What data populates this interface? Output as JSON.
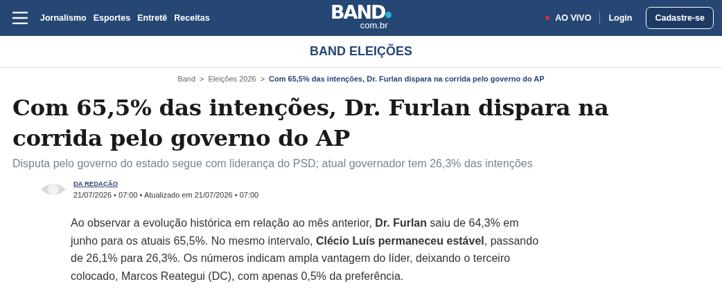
{
  "header": {
    "nav": [
      "Jornalismo",
      "Esportes",
      "Entretê",
      "Receitas"
    ],
    "logo": {
      "name": "BAND",
      "suffix": "com.br"
    },
    "live": "AO VIVO",
    "login": "Login",
    "signup": "Cadastre-se"
  },
  "section_title": "BAND ELEIÇÕES",
  "breadcrumb": [
    {
      "label": "Band",
      "current": false
    },
    {
      "label": "Eleições 2026",
      "current": false
    },
    {
      "label": "Com 65,5% das intenções, Dr. Furlan dispara na corrida pelo governo do AP",
      "current": true
    }
  ],
  "breadcrumb_separator": ">",
  "headline": "Com 65,5% das intenções, Dr. Furlan dispara na corrida pelo governo do AP",
  "subtitle": "Disputa pelo governo do estado segue com liderança do PSD; atual governador tem 26,3% das intenções",
  "author": {
    "name": "DA REDAÇÃO",
    "meta": "21/07/2026 • 07:00 • Atualizado em 21/07/2026 • 07:00"
  },
  "body": "Ao observar a evolução histórica em relação ao mês anterior, **Dr. Furlan** saiu de 64,3% em junho para os atuais 65,5%. No mesmo intervalo, **Clécio Luís permaneceu estável**, passando de 26,1% para 26,3%. Os números indicam ampla vantagem do líder, deixando o terceiro colocado, Marcos Reategui (DC), com apenas 0,5% da preferência."
}
